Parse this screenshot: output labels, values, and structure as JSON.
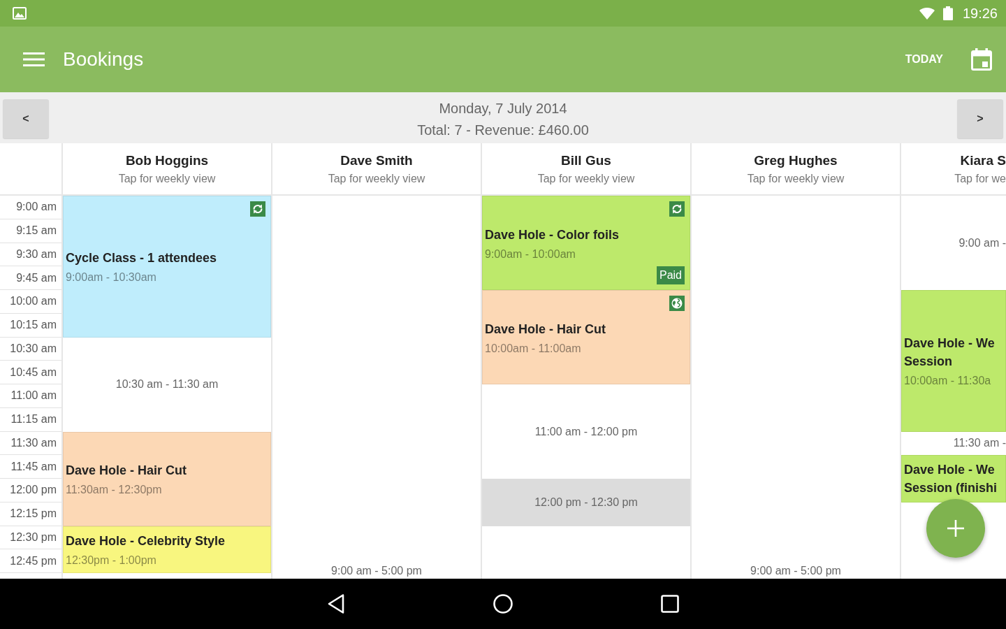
{
  "status_bar": {
    "time": "19:26"
  },
  "app_bar": {
    "title": "Bookings",
    "today_button": "TODAY"
  },
  "date_bar": {
    "prev_button": "<",
    "date": "Monday, 7 July 2014",
    "summary": "Total: 7 - Revenue: £460.00",
    "next_button": ">"
  },
  "time_slots": [
    "9:00 am",
    "9:15 am",
    "9:30 am",
    "9:45 am",
    "10:00 am",
    "10:15 am",
    "10:30 am",
    "10:45 am",
    "11:00 am",
    "11:15 am",
    "11:30 am",
    "11:45 am",
    "12:00 pm",
    "12:15 pm",
    "12:30 pm",
    "12:45 pm"
  ],
  "columns": [
    {
      "name": "Bob Hoggins",
      "subtitle": "Tap for weekly view",
      "blocks": [
        {
          "kind": "booking",
          "title": "Cycle Class - 1 attendees",
          "time": "9:00am - 10:30am",
          "color": "#bfedfc",
          "synced": true,
          "online": false
        },
        {
          "kind": "free",
          "label": "10:30 am - 11:30 am"
        },
        {
          "kind": "booking",
          "title": "Dave Hole - Hair Cut",
          "time": "11:30am - 12:30pm",
          "color": "#fcd8b5",
          "synced": false,
          "online": false
        },
        {
          "kind": "booking",
          "title": "Dave Hole - Celebrity Style",
          "time": "12:30pm - 1:00pm",
          "color": "#f8f67f",
          "synced": false,
          "online": false
        }
      ]
    },
    {
      "name": "Dave Smith",
      "subtitle": "Tap for weekly view",
      "blocks": [
        {
          "kind": "free",
          "label": "9:00 am - 5:00 pm"
        }
      ]
    },
    {
      "name": "Bill Gus",
      "subtitle": "Tap for weekly view",
      "blocks": [
        {
          "kind": "booking",
          "title": "Dave Hole - Color foils",
          "time": "9:00am - 10:00am",
          "color": "#bde96b",
          "synced": true,
          "online": false,
          "badge": "Paid"
        },
        {
          "kind": "booking",
          "title": "Dave Hole - Hair Cut",
          "time": "10:00am - 11:00am",
          "color": "#fcd8b5",
          "synced": false,
          "online": true
        },
        {
          "kind": "free",
          "label": "11:00 am - 12:00 pm"
        },
        {
          "kind": "blocked",
          "label": "12:00 pm - 12:30 pm"
        }
      ]
    },
    {
      "name": "Greg Hughes",
      "subtitle": "Tap for weekly view",
      "blocks": [
        {
          "kind": "free",
          "label": "9:00 am - 5:00 pm"
        }
      ]
    },
    {
      "name": "Kiara S",
      "subtitle": "Tap for we",
      "blocks": [
        {
          "kind": "free",
          "label": "9:00 am -"
        },
        {
          "kind": "booking",
          "title": "Dave Hole - We\nSession",
          "time": "10:00am - 11:30a",
          "color": "#bde96b",
          "synced": false,
          "online": false
        },
        {
          "kind": "free",
          "label": "11:30 am -"
        },
        {
          "kind": "booking",
          "title": "Dave Hole - We\nSession (finishi",
          "color": "#bde96b",
          "synced": false,
          "online": false
        }
      ]
    }
  ]
}
